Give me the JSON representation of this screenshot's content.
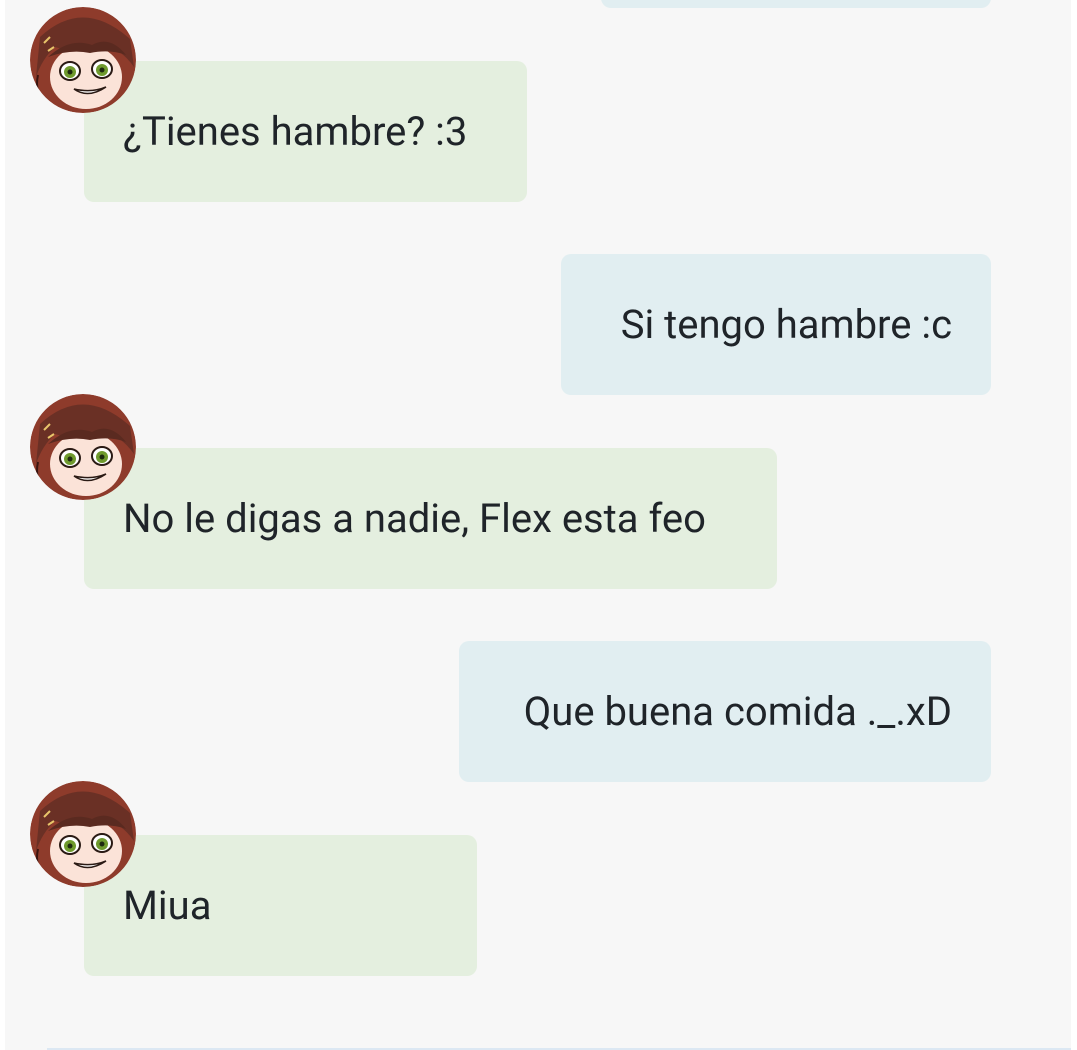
{
  "conversation": {
    "messages": [
      {
        "direction": "outgoing",
        "text": ""
      },
      {
        "direction": "incoming",
        "text": "¿Tienes hambre? :3"
      },
      {
        "direction": "outgoing",
        "text": "Si tengo hambre :c"
      },
      {
        "direction": "incoming",
        "text": "No le digas a nadie, Flex esta feo"
      },
      {
        "direction": "outgoing",
        "text": "Que buena comida ._.xD"
      },
      {
        "direction": "incoming",
        "text": "Miua"
      }
    ],
    "avatar_icon": "anime-girl-avatar-icon"
  },
  "colors": {
    "background": "#f7f7f7",
    "incoming_bubble": "#e4efdf",
    "outgoing_bubble": "#e1eef1",
    "text": "#1f2429"
  }
}
